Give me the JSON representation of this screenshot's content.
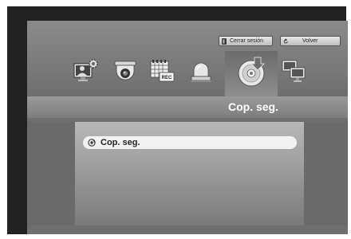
{
  "header": {
    "logout_label": "Cerrar sesión",
    "back_label": "Volver"
  },
  "menu": {
    "icons": [
      "monitor-settings-icon",
      "camera-icon",
      "schedule-rec-icon",
      "alarm-icon",
      "backup-disc-icon",
      "network-icon"
    ],
    "active_index": 4
  },
  "title": "Cop. seg.",
  "list": {
    "items": [
      {
        "label": "Cop. seg."
      }
    ]
  },
  "colors": {
    "frame": "#222222",
    "panel": "#6f6f6f",
    "item_bg": "#f2f2f2",
    "title_text": "#ffffff"
  }
}
